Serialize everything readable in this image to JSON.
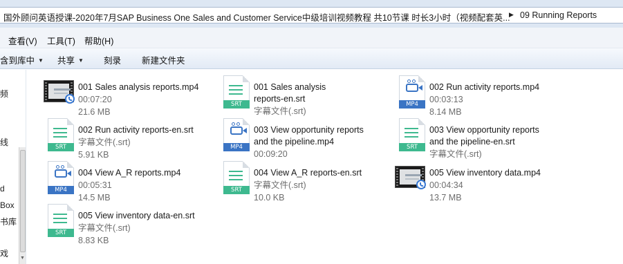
{
  "address": {
    "path": "国外顾问英语授课-2020年7月SAP Business One Sales and Customer Service中级培训视频教程 共10节课 时长3小时（视频配套英...",
    "current_folder": "09 Running Reports"
  },
  "menu": {
    "view": "查看(V)",
    "tools": "工具(T)",
    "help": "帮助(H)"
  },
  "toolbar": {
    "include_in_library": "含到库中",
    "share": "共享",
    "burn": "刻录",
    "new_folder": "新建文件夹"
  },
  "nav_fragments": [
    "频",
    "线",
    "d",
    "Box",
    "书库",
    "戏"
  ],
  "files": [
    {
      "name": "001 Sales analysis reports.mp4",
      "line2": "00:07:20",
      "line3": "21.6 MB",
      "icon": "video-thumbnail-icon"
    },
    {
      "name": "001 Sales analysis reports-en.srt",
      "line2": "字幕文件(.srt)",
      "line3": "",
      "icon": "srt-file-icon",
      "label": "SRT"
    },
    {
      "name": "002 Run activity reports.mp4",
      "line2": "00:03:13",
      "line3": "8.14 MB",
      "icon": "mp4-file-icon",
      "label": "MP4"
    },
    {
      "name": "002 Run activity reports-en.srt",
      "line2": "字幕文件(.srt)",
      "line3": "5.91 KB",
      "icon": "srt-file-icon",
      "label": "SRT"
    },
    {
      "name": "003 View opportunity reports and the pipeline.mp4",
      "line2": "00:09:20",
      "line3": "",
      "icon": "mp4-file-icon",
      "label": "MP4"
    },
    {
      "name": "003 View opportunity reports and the pipeline-en.srt",
      "line2": "字幕文件(.srt)",
      "line3": "",
      "icon": "srt-file-icon",
      "label": "SRT"
    },
    {
      "name": "004 View A_R reports.mp4",
      "line2": "00:05:31",
      "line3": "14.5 MB",
      "icon": "mp4-file-icon",
      "label": "MP4"
    },
    {
      "name": "004 View A_R reports-en.srt",
      "line2": "字幕文件(.srt)",
      "line3": "10.0 KB",
      "icon": "srt-file-icon",
      "label": "SRT"
    },
    {
      "name": "005 View inventory data.mp4",
      "line2": "00:04:34",
      "line3": "13.7 MB",
      "icon": "video-thumbnail-icon"
    },
    {
      "name": "005 View inventory data-en.srt",
      "line2": "字幕文件(.srt)",
      "line3": "8.83 KB",
      "icon": "srt-file-icon",
      "label": "SRT"
    }
  ],
  "colors": {
    "srt": "#3eb98f",
    "mp4": "#3a74c4",
    "toolbar": "#e2eaf5"
  }
}
